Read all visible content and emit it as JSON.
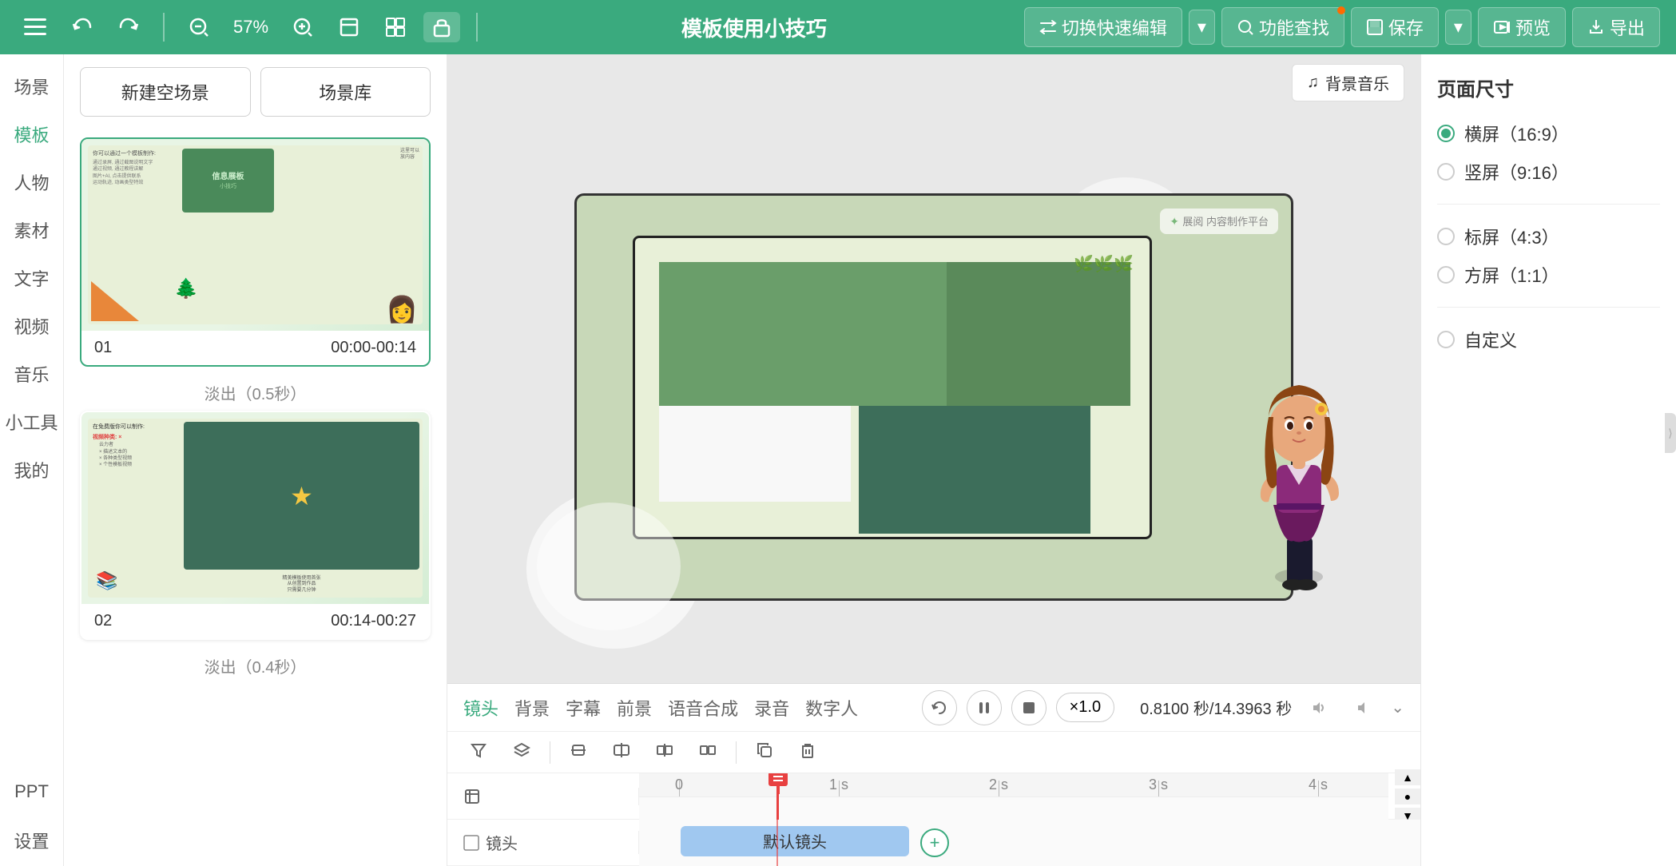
{
  "app": {
    "title": "模板使用小技巧"
  },
  "toolbar": {
    "undo_label": "↺",
    "redo_label": "↻",
    "zoom_value": "57%",
    "zoom_out": "⊖",
    "zoom_in": "⊕",
    "fullscreen": "⛶",
    "switch_edit_label": "切换快速编辑",
    "feature_search_label": "功能查找",
    "save_label": "保存",
    "preview_label": "预览",
    "export_label": "导出"
  },
  "sidebar": {
    "items": [
      {
        "label": "场景"
      },
      {
        "label": "模板"
      },
      {
        "label": "人物"
      },
      {
        "label": "素材"
      },
      {
        "label": "文字"
      },
      {
        "label": "视频"
      },
      {
        "label": "音乐"
      },
      {
        "label": "小工具"
      },
      {
        "label": "我的"
      },
      {
        "label": "PPT"
      },
      {
        "label": "设置"
      }
    ]
  },
  "scene_panel": {
    "new_scene_btn": "新建空场景",
    "scene_library_btn": "场景库",
    "scenes": [
      {
        "index": "01",
        "time": "00:00-00:14",
        "transition": "淡出（0.5秒）"
      },
      {
        "index": "02",
        "time": "00:14-00:27",
        "transition": "淡出（0.4秒）"
      }
    ]
  },
  "canvas": {
    "bg_music_btn": "背景音乐"
  },
  "timeline": {
    "tabs": [
      {
        "label": "镜头",
        "active": true
      },
      {
        "label": "背景"
      },
      {
        "label": "字幕"
      },
      {
        "label": "前景"
      },
      {
        "label": "语音合成"
      },
      {
        "label": "录音"
      },
      {
        "label": "数字人"
      }
    ],
    "time_display": "0.8100 秒/14.3963 秒",
    "speed_label": "×1.0",
    "ruler_marks": [
      "0",
      "1 s",
      "2 s",
      "3 s",
      "4 s"
    ],
    "camera_row_label": "□ 镜头",
    "default_camera_clip": "默认镜头",
    "add_btn": "+"
  },
  "right_panel": {
    "title": "页面尺寸",
    "options": [
      {
        "label": "横屏（16:9）",
        "active": true
      },
      {
        "label": "竖屏（9:16）",
        "active": false
      },
      {
        "label": "标屏（4:3）",
        "active": false
      },
      {
        "label": "方屏（1:1）",
        "active": false
      },
      {
        "label": "自定义",
        "active": false
      }
    ]
  }
}
